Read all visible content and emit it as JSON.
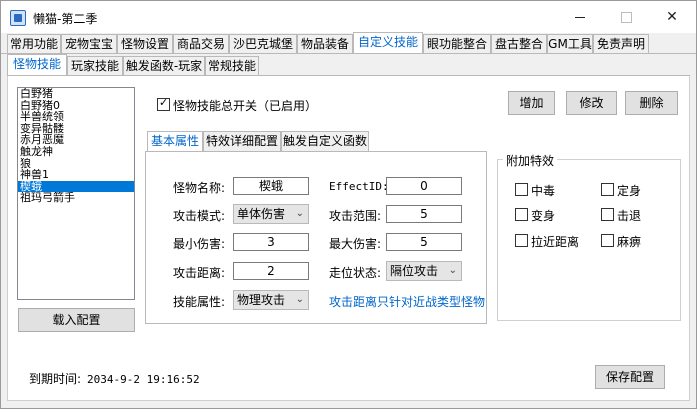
{
  "window": {
    "title": "懒猫-第二季"
  },
  "main_tabs": [
    "常用功能",
    "宠物宝宝",
    "怪物设置",
    "商品交易",
    "沙巴克城堡",
    "物品装备",
    "自定义技能",
    "眼功能整合",
    "盘古整合",
    "GM工具",
    "免责声明"
  ],
  "main_tab_active": "自定义技能",
  "sub_tabs": [
    "怪物技能",
    "玩家技能",
    "触发函数-玩家",
    "常规技能"
  ],
  "sub_tab_active": "怪物技能",
  "monster_list": [
    "白野猪",
    "白野猪0",
    "半兽统领",
    "变异骷髅",
    "赤月恶魔",
    "触龙神",
    "狼",
    "神兽1",
    "楔蛾",
    "祖玛弓箭手"
  ],
  "monster_selected": "楔蛾",
  "load_button": "载入配置",
  "master_switch_label": "怪物技能总开关（已启用）",
  "master_switch_checked": true,
  "buttons": {
    "add": "增加",
    "modify": "修改",
    "delete": "删除",
    "save": "保存配置"
  },
  "inner_tabs": [
    "基本属性",
    "特效详细配置",
    "触发自定义函数"
  ],
  "inner_tab_active": "基本属性",
  "form": {
    "monster_name_label": "怪物名称:",
    "monster_name": "楔蛾",
    "effect_id_label": "EffectID:",
    "effect_id": "0",
    "attack_mode_label": "攻击模式:",
    "attack_mode": "单体伤害",
    "attack_range_label": "攻击范围:",
    "attack_range": "5",
    "min_damage_label": "最小伤害:",
    "min_damage": "3",
    "max_damage_label": "最大伤害:",
    "max_damage": "5",
    "attack_distance_label": "攻击距离:",
    "attack_distance": "2",
    "move_state_label": "走位状态:",
    "move_state": "隔位攻击",
    "skill_attr_label": "技能属性:",
    "skill_attr": "物理攻击",
    "note": "攻击距离只针对近战类型怪物"
  },
  "effects": {
    "title": "附加特效",
    "items": [
      {
        "label": "中毒",
        "checked": false
      },
      {
        "label": "定身",
        "checked": false
      },
      {
        "label": "变身",
        "checked": false
      },
      {
        "label": "击退",
        "checked": false
      },
      {
        "label": "拉近距离",
        "checked": false
      },
      {
        "label": "麻痹",
        "checked": false
      }
    ]
  },
  "status": {
    "expire_label": "到期时间:",
    "expire_time": "2034-9-2 19:16:52"
  },
  "colors": {
    "accent": "#0066cc",
    "selection": "#0078d7"
  }
}
